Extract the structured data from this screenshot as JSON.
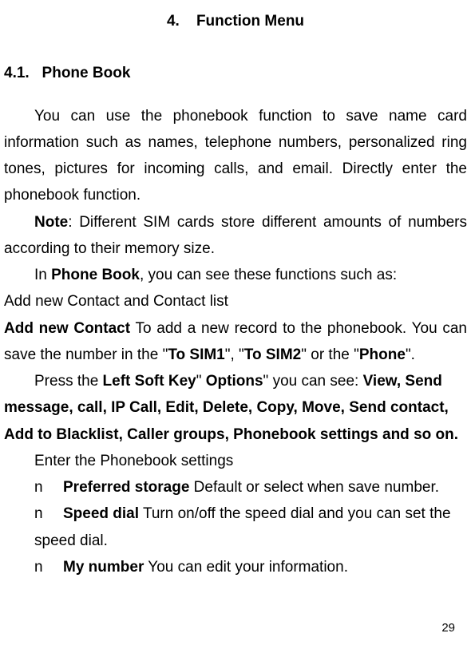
{
  "chapter": {
    "number": "4.",
    "title": "Function Menu"
  },
  "section": {
    "number": "4.1.",
    "title": "Phone Book"
  },
  "p1": "You can use the phonebook function to save name card information such as names, telephone numbers, personalized ring tones, pictures for incoming calls, and email. Directly enter the phonebook function.",
  "p2_note": "Note",
  "p2_rest": ": Different SIM cards store different amounts of numbers according to their memory size.",
  "p3_a": "In ",
  "p3_b": "Phone Book",
  "p3_c": ", you can see these functions such as:",
  "p4": "Add new Contact and Contact list",
  "p5_a": "Add new Contact",
  "p5_b": " To add a new record to the phonebook. You can save the number in the \"",
  "p5_c": "To SIM1",
  "p5_d": "\", \"",
  "p5_e": "To SIM2",
  "p5_f": "\" or the \"",
  "p5_g": "Phone",
  "p5_h": "\".",
  "p6_a": "Press the ",
  "p6_b": "Left Soft Key",
  "p6_c": "\" ",
  "p6_d": "Options",
  "p6_e": "\" you can see: ",
  "p6_f": "View, Send message, call, IP Call, Edit, Delete, Copy, Move, Send contact, Add to Blacklist, Caller groups, Phonebook settings and so on.",
  "p7": "Enter the Phonebook settings",
  "list": {
    "bullet": "n",
    "item1_b": "Preferred storage",
    "item1_r": " Default or select when save number.",
    "item2_b": "Speed dial",
    "item2_r": " Turn on/off the speed dial and you can set the speed dial.",
    "item3_b": "My number",
    "item3_r": " You can edit your information."
  },
  "page_number": "29"
}
